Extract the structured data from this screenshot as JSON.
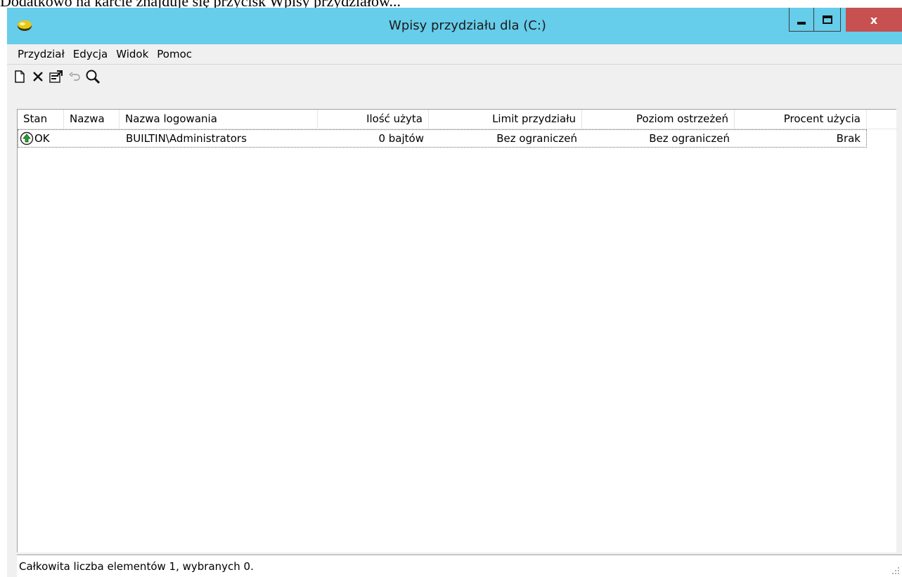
{
  "doc_caption": "Dodatkowo na karcie znajduje się przycisk Wpisy przydziałów...",
  "window": {
    "title": "Wpisy przydziału dla (C:)",
    "close_glyph": "x",
    "accent_color": "#66cdea",
    "close_color": "#c75050"
  },
  "menu": {
    "items": [
      "Przydział",
      "Edycja",
      "Widok",
      "Pomoc"
    ]
  },
  "toolbar": {
    "buttons": [
      "new-document-icon",
      "delete-icon",
      "properties-icon",
      "undo-icon",
      "find-icon"
    ]
  },
  "table": {
    "columns": [
      "Stan",
      "Nazwa",
      "Nazwa logowania",
      "Ilość użyta",
      "Limit przydziału",
      "Poziom ostrzeżeń",
      "Procent użycia"
    ],
    "rows": [
      {
        "status": "OK",
        "status_icon": "ok-arrow-icon",
        "name": "",
        "logon_name": "BUILTIN\\Administrators",
        "amount_used": "0 bajtów",
        "quota_limit": "Bez ograniczeń",
        "warning_level": "Bez ograniczeń",
        "percent_used": "Brak"
      }
    ]
  },
  "statusbar": {
    "text": "Całkowita liczba elementów 1, wybranych 0."
  }
}
